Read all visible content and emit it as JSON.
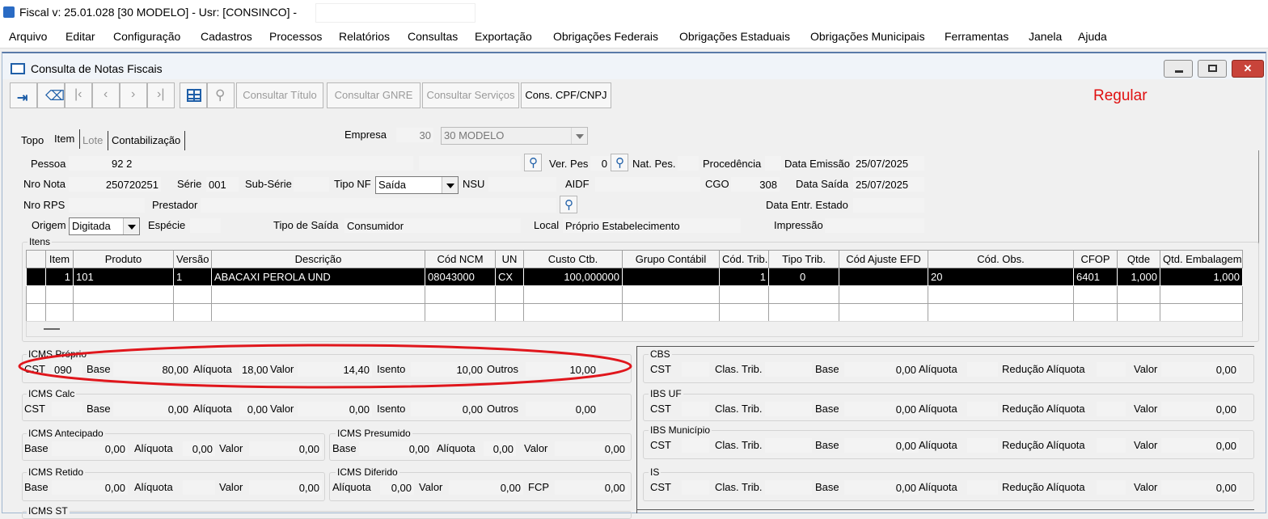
{
  "window": {
    "title": "Fiscal  v: 25.01.028   [30 MODELO] - Usr: [CONSINCO] -"
  },
  "menu": [
    "Arquivo",
    "Editar",
    "Configuração",
    "Cadastros",
    "Processos",
    "Relatórios",
    "Consultas",
    "Exportação",
    "Obrigações Federais",
    "Obrigações Estaduais",
    "Obrigações Municipais",
    "Ferramentas",
    "Janela",
    "Ajuda"
  ],
  "child": {
    "title": "Consulta de Notas Fiscais",
    "status": "Regular"
  },
  "toolbar": {
    "consultar_titulo": "Consultar Título",
    "consultar_gnre": "Consultar GNRE",
    "consultar_servicos": "Consultar Serviços",
    "cons_cpf": "Cons. CPF/CNPJ"
  },
  "tabs": [
    "Topo",
    "Item",
    "Lote",
    "Contabilização"
  ],
  "header": {
    "empresa_label": "Empresa",
    "empresa_code": "30",
    "empresa_name": "30 MODELO",
    "pessoa_label": "Pessoa",
    "pessoa": "92 2",
    "verpes_label": "Ver. Pes",
    "verpes": "0",
    "natpes_label": "Nat. Pes.",
    "procedencia_label": "Procedência",
    "data_emissao_label": "Data Emissão",
    "data_emissao": "25/07/2025",
    "nro_nota_label": "Nro Nota",
    "nro_nota": "250720251",
    "serie_label": "Série",
    "serie": "001",
    "subserie_label": "Sub-Série",
    "tipo_nf_label": "Tipo NF",
    "tipo_nf": "Saída",
    "nsu_label": "NSU",
    "aidf_label": "AIDF",
    "cgo_label": "CGO",
    "cgo": "308",
    "data_saida_label": "Data Saída",
    "data_saida": "25/07/2025",
    "nro_rps_label": "Nro RPS",
    "prestador_label": "Prestador",
    "data_entr_label": "Data Entr. Estado",
    "origem_label": "Origem",
    "origem": "Digitada",
    "especie_label": "Espécie",
    "tipo_saida_label": "Tipo de Saída",
    "tipo_saida": "Consumidor",
    "local_label": "Local",
    "local": "Próprio Estabelecimento",
    "impressao_label": "Impressão"
  },
  "itens": {
    "title": "Itens",
    "columns": [
      "Item",
      "Produto",
      "Versão",
      "Descrição",
      "Cód NCM",
      "UN",
      "Custo Ctb.",
      "Grupo Contábil",
      "Cód. Trib.",
      "Tipo Trib.",
      "Cód Ajuste EFD",
      "Cód. Obs.",
      "CFOP",
      "Qtde",
      "Qtd. Embalagem"
    ],
    "rows": [
      [
        "1",
        "101",
        "1",
        "ABACAXI PEROLA UND",
        "08043000",
        "CX",
        "100,000000",
        "",
        "1",
        "0",
        "",
        "20",
        "6401",
        "1,000",
        "1,000"
      ]
    ]
  },
  "icms_proprio": {
    "title": "ICMS Próprio",
    "cst_label": "CST",
    "cst": "090",
    "base_label": "Base",
    "base": "80,00",
    "aliq_label": "Alíquota",
    "aliq": "18,00",
    "valor_label": "Valor",
    "valor": "14,40",
    "isento_label": "Isento",
    "isento": "10,00",
    "outros_label": "Outros",
    "outros": "10,00"
  },
  "icms_calc": {
    "title": "ICMS Calc",
    "cst_label": "CST",
    "base_label": "Base",
    "base": "0,00",
    "aliq_label": "Alíquota",
    "aliq": "0,00",
    "valor_label": "Valor",
    "valor": "0,00",
    "isento_label": "Isento",
    "isento": "0,00",
    "outros_label": "Outros",
    "outros": "0,00"
  },
  "icms_antecipado": {
    "title": "ICMS Antecipado",
    "base_label": "Base",
    "base": "0,00",
    "aliq_label": "Alíquota",
    "aliq": "0,00",
    "valor_label": "Valor",
    "valor": "0,00"
  },
  "icms_presumido": {
    "title": "ICMS Presumido",
    "base_label": "Base",
    "base": "0,00",
    "aliq_label": "Alíquota",
    "aliq": "0,00",
    "valor_label": "Valor",
    "valor": "0,00"
  },
  "icms_retido": {
    "title": "ICMS Retido",
    "base_label": "Base",
    "base": "0,00",
    "aliq_label": "Alíquota",
    "valor_label": "Valor",
    "valor": "0,00"
  },
  "icms_diferido": {
    "title": "ICMS Diferido",
    "aliq_label": "Alíquota",
    "aliq": "0,00",
    "valor_label": "Valor",
    "valor": "0,00",
    "fcp_label": "FCP",
    "fcp": "0,00"
  },
  "icms_st": {
    "title": "ICMS ST"
  },
  "tax_groups": [
    {
      "title": "CBS",
      "cst_label": "CST",
      "clas_label": "Clas. Trib.",
      "base_label": "Base",
      "base": "0,00",
      "aliq_label": "Alíquota",
      "red_label": "Redução Alíquota",
      "valor_label": "Valor",
      "valor": "0,00"
    },
    {
      "title": "IBS UF",
      "cst_label": "CST",
      "clas_label": "Clas. Trib.",
      "base_label": "Base",
      "base": "0,00",
      "aliq_label": "Alíquota",
      "red_label": "Redução Alíquota",
      "valor_label": "Valor",
      "valor": "0,00"
    },
    {
      "title": "IBS Município",
      "cst_label": "CST",
      "clas_label": "Clas. Trib.",
      "base_label": "Base",
      "base": "0,00",
      "aliq_label": "Alíquota",
      "red_label": "Redução Alíquota",
      "valor_label": "Valor",
      "valor": "0,00"
    },
    {
      "title": "IS",
      "cst_label": "CST",
      "clas_label": "Clas. Trib.",
      "base_label": "Base",
      "base": "0,00",
      "aliq_label": "Alíquota",
      "red_label": "Redução Alíquota",
      "valor_label": "Valor",
      "valor": "0,00"
    }
  ],
  "colors": {
    "highlight": "#e0161c",
    "status": "#e01010",
    "accent": "#1f5fa8"
  }
}
